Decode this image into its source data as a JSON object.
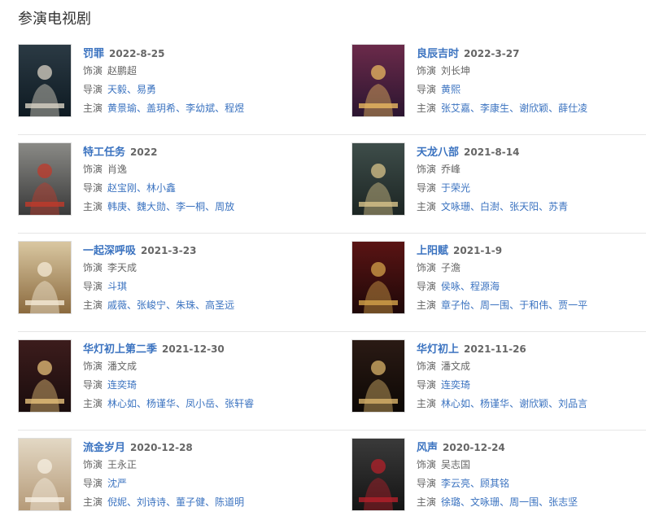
{
  "section_title": "参演电视剧",
  "labels": {
    "role": "饰演",
    "director": "导演",
    "cast": "主演"
  },
  "separator": "、",
  "works": [
    {
      "title": "罚罪",
      "date": "2022-8-25",
      "role": "赵鹏超",
      "directors": [
        "天毅",
        "易勇"
      ],
      "cast": [
        "黄景瑜",
        "盖玥希",
        "李幼斌",
        "程煜"
      ],
      "poster_colors": [
        "#2b3a44",
        "#0e1a22",
        "#d9d2c4"
      ]
    },
    {
      "title": "良辰吉时",
      "date": "2022-3-27",
      "role": "刘长坤",
      "directors": [
        "黄熙"
      ],
      "cast": [
        "张艾嘉",
        "李康生",
        "谢欣颖",
        "薛仕凌"
      ],
      "poster_colors": [
        "#6b2a4a",
        "#2b1530",
        "#e8b860"
      ]
    },
    {
      "title": "特工任务",
      "date": "2022",
      "role": "肖逸",
      "directors": [
        "赵宝刚",
        "林小鑫"
      ],
      "cast": [
        "韩庚",
        "魏大勋",
        "李一桐",
        "周放"
      ],
      "poster_colors": [
        "#8a8a86",
        "#3a3a3a",
        "#c0392b"
      ]
    },
    {
      "title": "天龙八部",
      "date": "2021-8-14",
      "role": "乔峰",
      "directors": [
        "于荣光"
      ],
      "cast": [
        "文咏珊",
        "白澍",
        "张天阳",
        "苏青"
      ],
      "poster_colors": [
        "#3e4d4a",
        "#1c2523",
        "#d8c38a"
      ]
    },
    {
      "title": "一起深呼吸",
      "date": "2021-3-23",
      "role": "李天成",
      "directors": [
        "斗琪"
      ],
      "cast": [
        "戚薇",
        "张峻宁",
        "朱珠",
        "高圣远"
      ],
      "poster_colors": [
        "#d9c7a1",
        "#8b6a3e",
        "#f4ead6"
      ]
    },
    {
      "title": "上阳赋",
      "date": "2021-1-9",
      "role": "子澹",
      "directors": [
        "侯咏",
        "程源海"
      ],
      "cast": [
        "章子怡",
        "周一围",
        "于和伟",
        "贾一平"
      ],
      "poster_colors": [
        "#5a1414",
        "#1e0808",
        "#d4a24a"
      ]
    },
    {
      "title": "华灯初上第二季",
      "date": "2021-12-30",
      "role": "潘文成",
      "directors": [
        "连奕琦"
      ],
      "cast": [
        "林心如",
        "杨谨华",
        "凤小岳",
        "张轩睿"
      ],
      "poster_colors": [
        "#3c1c1c",
        "#1a0d0d",
        "#e6c07a"
      ]
    },
    {
      "title": "华灯初上",
      "date": "2021-11-26",
      "role": "潘文成",
      "directors": [
        "连奕琦"
      ],
      "cast": [
        "林心如",
        "杨谨华",
        "谢欣颖",
        "刘品言"
      ],
      "poster_colors": [
        "#2a1a14",
        "#0d0805",
        "#d9b36a"
      ]
    },
    {
      "title": "流金岁月",
      "date": "2020-12-28",
      "role": "王永正",
      "directors": [
        "沈严"
      ],
      "cast": [
        "倪妮",
        "刘诗诗",
        "董子健",
        "陈道明"
      ],
      "poster_colors": [
        "#e3d8c4",
        "#b59a78",
        "#f6efe2"
      ]
    },
    {
      "title": "风声",
      "date": "2020-12-24",
      "role": "吴志国",
      "directors": [
        "李云亮",
        "顾其铭"
      ],
      "cast": [
        "徐璐",
        "文咏珊",
        "周一围",
        "张志坚"
      ],
      "poster_colors": [
        "#3a3a3a",
        "#141414",
        "#b3202a"
      ]
    }
  ]
}
